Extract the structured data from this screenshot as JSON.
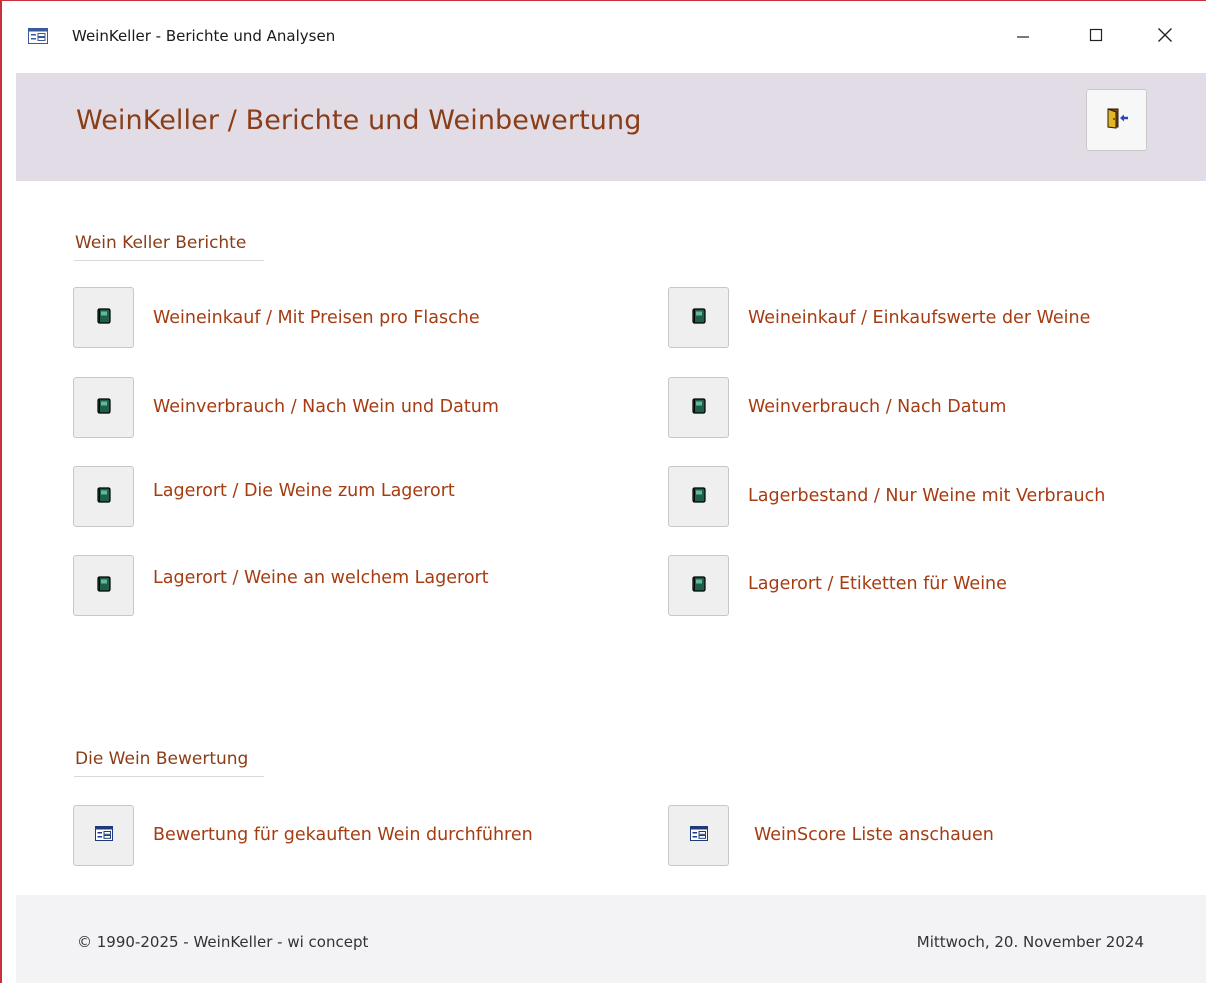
{
  "window": {
    "title": "WeinKeller - Berichte und Analysen",
    "icon": "form-icon"
  },
  "header": {
    "title": "WeinKeller / Berichte und Weinbewertung",
    "exit_icon": "exit-door-icon"
  },
  "sections": {
    "reports": {
      "title": "Wein Keller Berichte",
      "items": [
        {
          "label": "Weineinkauf / Mit Preisen pro Flasche",
          "icon": "report-book-icon"
        },
        {
          "label": "Weineinkauf / Einkaufswerte der Weine",
          "icon": "report-book-icon"
        },
        {
          "label": "Weinverbrauch / Nach Wein und Datum",
          "icon": "report-book-icon"
        },
        {
          "label": "Weinverbrauch / Nach Datum",
          "icon": "report-book-icon"
        },
        {
          "label": "Lagerort / Die Weine zum Lagerort",
          "icon": "report-book-icon"
        },
        {
          "label": "Lagerbestand / Nur Weine mit Verbrauch",
          "icon": "report-book-icon"
        },
        {
          "label": "Lagerort / Weine an welchem Lagerort",
          "icon": "report-book-icon"
        },
        {
          "label": "Lagerort / Etiketten für Weine",
          "icon": "report-book-icon"
        }
      ]
    },
    "rating": {
      "title": "Die Wein Bewertung",
      "items": [
        {
          "label": "Bewertung für gekauften Wein durchführen",
          "icon": "form-icon"
        },
        {
          "label": "WeinScore Liste anschauen",
          "icon": "form-icon"
        }
      ]
    }
  },
  "footer": {
    "copyright": "© 1990-2025 - WeinKeller - wi concept",
    "date": "Mittwoch, 20. November 2024"
  },
  "colors": {
    "accent": "#a53c12",
    "header_bg": "#e1dce6",
    "border": "#c9303a"
  }
}
